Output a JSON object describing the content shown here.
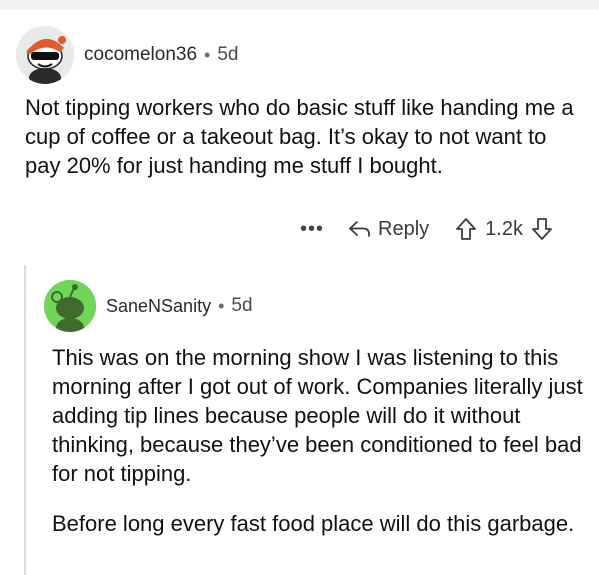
{
  "comment1": {
    "username": "cocomelon36",
    "separator": "•",
    "age": "5d",
    "text": "Not tipping workers who do basic stuff like handing me a cup of coffee or a takeout bag. It’s okay to not want to pay 20% for just handing me stuff I bought.",
    "actions": {
      "more": "•••",
      "reply_label": "Reply",
      "score": "1.2k"
    }
  },
  "comment2": {
    "username": "SaneNSanity",
    "separator": "•",
    "age": "5d",
    "paragraph1": "This was on the morning show I was listening to this morning after I got out of work. Companies literally just adding tip lines because people will do it without thinking, because they’ve been conditioned to feel bad for not tipping.",
    "paragraph2": "Before long every fast food place will do this garbage."
  },
  "icons": {
    "reply": "reply-arrow-icon",
    "upvote": "upvote-arrow-icon",
    "downvote": "downvote-arrow-icon"
  },
  "colors": {
    "avatar2_bg": "#6fd65a",
    "avatar1_bg": "#e9e9e9",
    "thread_line": "#dcdcdc"
  }
}
